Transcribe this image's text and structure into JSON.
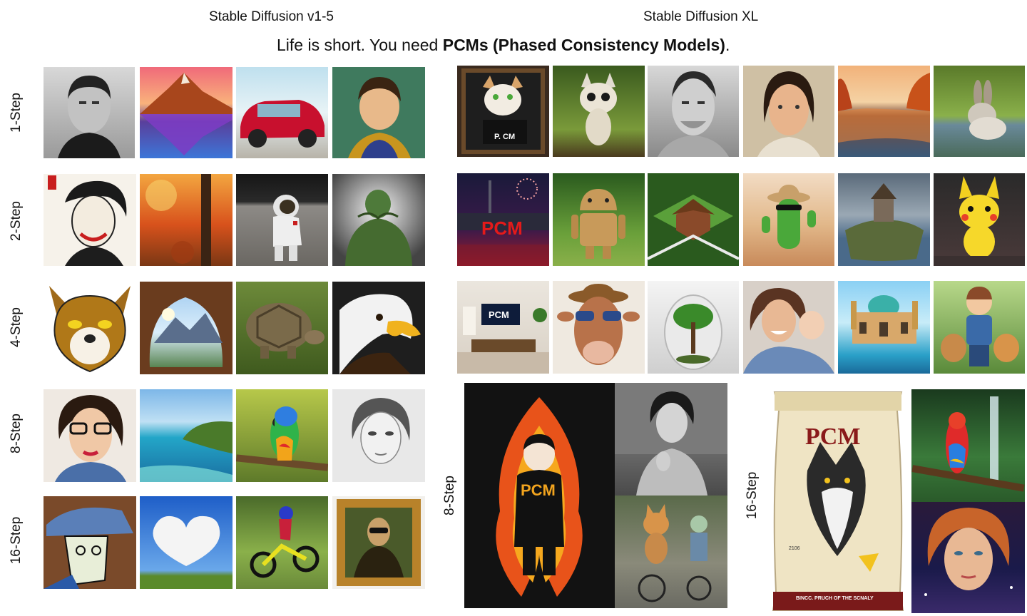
{
  "headers": {
    "left": "Stable Diffusion v1-5",
    "right": "Stable Diffusion XL"
  },
  "subtitle": {
    "prefix": "Life is short. You need ",
    "bold": "PCMs (Phased Consistency Models)",
    "suffix": "."
  },
  "rows": {
    "r1": "1-Step",
    "r2": "2-Step",
    "r3": "4-Step",
    "r4": "8-Step",
    "r5": "16-Step",
    "xl8": "8-Step",
    "xl16": "16-Step"
  },
  "image_text": {
    "cat_sign": "P. CM",
    "city_sign": "PCM",
    "tv": "PCM",
    "sweater": "PCM",
    "bag_brand": "PCM",
    "bag_small": "2106",
    "bag_bottom": "BINCC. PRUCH OF THE SCNALY"
  },
  "colors": {
    "background": "#ffffff",
    "text": "#111111"
  }
}
